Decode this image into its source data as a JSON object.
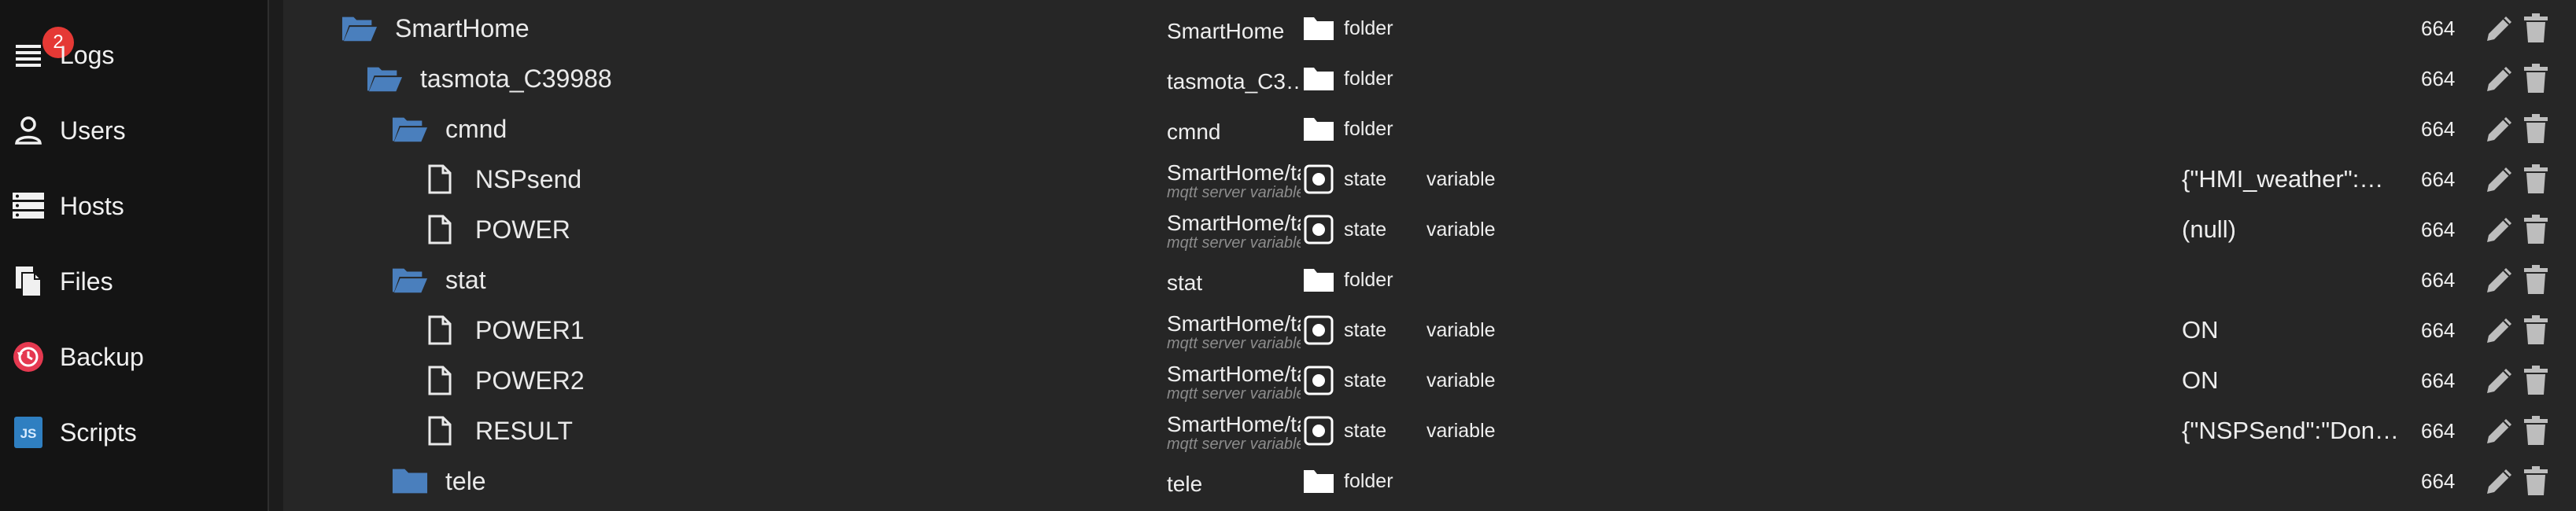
{
  "sidebar": {
    "items": [
      {
        "label": "Logs",
        "icon": "logs-icon",
        "badge": "2"
      },
      {
        "label": "Users",
        "icon": "user-icon"
      },
      {
        "label": "Hosts",
        "icon": "hosts-icon"
      },
      {
        "label": "Files",
        "icon": "files-icon"
      },
      {
        "label": "Backup",
        "icon": "backup-icon"
      },
      {
        "label": "Scripts",
        "icon": "scripts-icon",
        "icon_text": "JS"
      }
    ]
  },
  "rows": [
    {
      "name": "SmartHome",
      "id": "SmartHome",
      "type": "folder",
      "acl": "664"
    },
    {
      "name": "tasmota_C39988",
      "id": "tasmota_C3…",
      "type": "folder",
      "acl": "664"
    },
    {
      "name": "cmnd",
      "id": "cmnd",
      "type": "folder",
      "acl": "664"
    },
    {
      "name": "NSPsend",
      "id": "SmartHome/ta",
      "id_sub": "mqtt server variable",
      "type": "state",
      "role": "variable",
      "value": "{\"HMI_weather\":…",
      "acl": "664"
    },
    {
      "name": "POWER",
      "id": "SmartHome/ta",
      "id_sub": "mqtt server variable",
      "type": "state",
      "role": "variable",
      "value": "(null)",
      "acl": "664"
    },
    {
      "name": "stat",
      "id": "stat",
      "type": "folder",
      "acl": "664"
    },
    {
      "name": "POWER1",
      "id": "SmartHome/ta",
      "id_sub": "mqtt server variable",
      "type": "state",
      "role": "variable",
      "value": "ON",
      "acl": "664"
    },
    {
      "name": "POWER2",
      "id": "SmartHome/ta",
      "id_sub": "mqtt server variable",
      "type": "state",
      "role": "variable",
      "value": "ON",
      "acl": "664"
    },
    {
      "name": "RESULT",
      "id": "SmartHome/ta",
      "id_sub": "mqtt server variable",
      "type": "state",
      "role": "variable",
      "value": "{\"NSPSend\":\"Don…",
      "acl": "664"
    },
    {
      "name": "tele",
      "id": "tele",
      "type": "folder",
      "acl": "664"
    }
  ],
  "colors": {
    "folder_icon": "#4a7fbd",
    "badge": "#e53935",
    "backup_icon": "#e53950",
    "scripts_icon": "#2f7fc1"
  }
}
